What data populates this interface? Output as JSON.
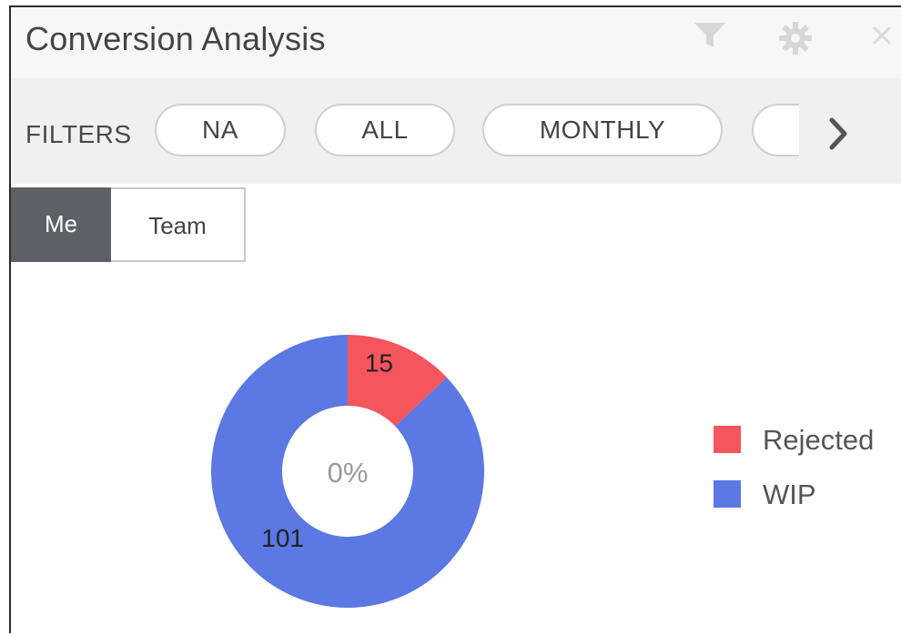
{
  "header": {
    "title": "Conversion Analysis",
    "icons": [
      "filter-icon",
      "gear-icon",
      "close-icon"
    ]
  },
  "filters": {
    "label": "FILTERS",
    "pills": [
      "NA",
      "ALL",
      "MONTHLY",
      ""
    ],
    "next_icon": "chevron-right-icon"
  },
  "view_toggle": {
    "options": [
      "Me",
      "Team"
    ],
    "selected": "Me"
  },
  "chart_data": {
    "type": "pie",
    "donut": true,
    "center_label": "0%",
    "categories": [
      "Rejected",
      "WIP"
    ],
    "values": [
      15,
      101
    ],
    "data_labels": [
      "15",
      "101"
    ],
    "colors": [
      "#f5555d",
      "#5b78e3"
    ],
    "legend_placement": "right"
  }
}
